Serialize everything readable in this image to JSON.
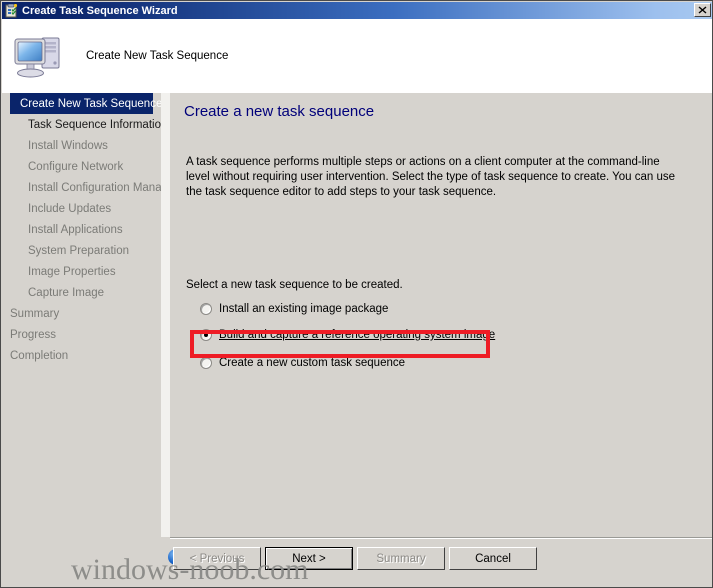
{
  "window": {
    "title": "Create Task Sequence Wizard",
    "title_icon": "task-sequence-clipboard-icon",
    "close_label": "✕",
    "titlebar_color_left": "#0a246a",
    "titlebar_color_right": "#a8c9f0"
  },
  "banner": {
    "icon": "computer-monitor-icon",
    "title": "Create New Task Sequence"
  },
  "sidebar": {
    "items": [
      {
        "label": "Create New Task Sequence",
        "level": 1,
        "state": "selected"
      },
      {
        "label": "Task Sequence Information",
        "level": 2,
        "state": "enabled"
      },
      {
        "label": "Install Windows",
        "level": 2,
        "state": "disabled"
      },
      {
        "label": "Configure Network",
        "level": 2,
        "state": "disabled"
      },
      {
        "label": "Install Configuration Manag",
        "level": 2,
        "state": "disabled"
      },
      {
        "label": "Include Updates",
        "level": 2,
        "state": "disabled"
      },
      {
        "label": "Install Applications",
        "level": 2,
        "state": "disabled"
      },
      {
        "label": "System Preparation",
        "level": 2,
        "state": "disabled"
      },
      {
        "label": "Image Properties",
        "level": 2,
        "state": "disabled"
      },
      {
        "label": "Capture Image",
        "level": 2,
        "state": "disabled"
      },
      {
        "label": "Summary",
        "level": 1,
        "state": "disabled"
      },
      {
        "label": "Progress",
        "level": 1,
        "state": "disabled"
      },
      {
        "label": "Completion",
        "level": 1,
        "state": "disabled"
      }
    ],
    "scrollbar": {
      "left_arrow": "◄",
      "right_arrow": "►"
    }
  },
  "content": {
    "heading": "Create a new task sequence",
    "intro": "A task sequence performs multiple steps or actions on a client computer at the command-line level without requiring user intervention. Select the type of task sequence to create. You can use the task sequence editor to add steps to your task sequence.",
    "select_label": "Select a new task sequence to be created.",
    "options": [
      {
        "label": "Install an existing image package",
        "accel": "Inst",
        "accel_letter": "a",
        "rest": "ll an existing image package",
        "selected": false
      },
      {
        "label": "Build and capture a reference operating system image",
        "accel": "",
        "accel_letter": "B",
        "rest": "uild and capture a reference operating system image",
        "selected": true
      },
      {
        "label": "Create a new custom task sequence",
        "accel": "C",
        "accel_letter": "r",
        "rest": "eate a new custom task sequence",
        "selected": false
      }
    ],
    "highlight_color": "#ee1c25"
  },
  "footer": {
    "help_icon": "help-question-icon",
    "help_glyph": "?",
    "buttons": [
      {
        "label": "< Previous",
        "state": "disabled"
      },
      {
        "label": "Next >",
        "state": "default"
      },
      {
        "label": "Summary",
        "state": "disabled"
      },
      {
        "label": "Cancel",
        "state": "enabled"
      }
    ]
  },
  "watermark": {
    "text": "windows-noob.com"
  }
}
